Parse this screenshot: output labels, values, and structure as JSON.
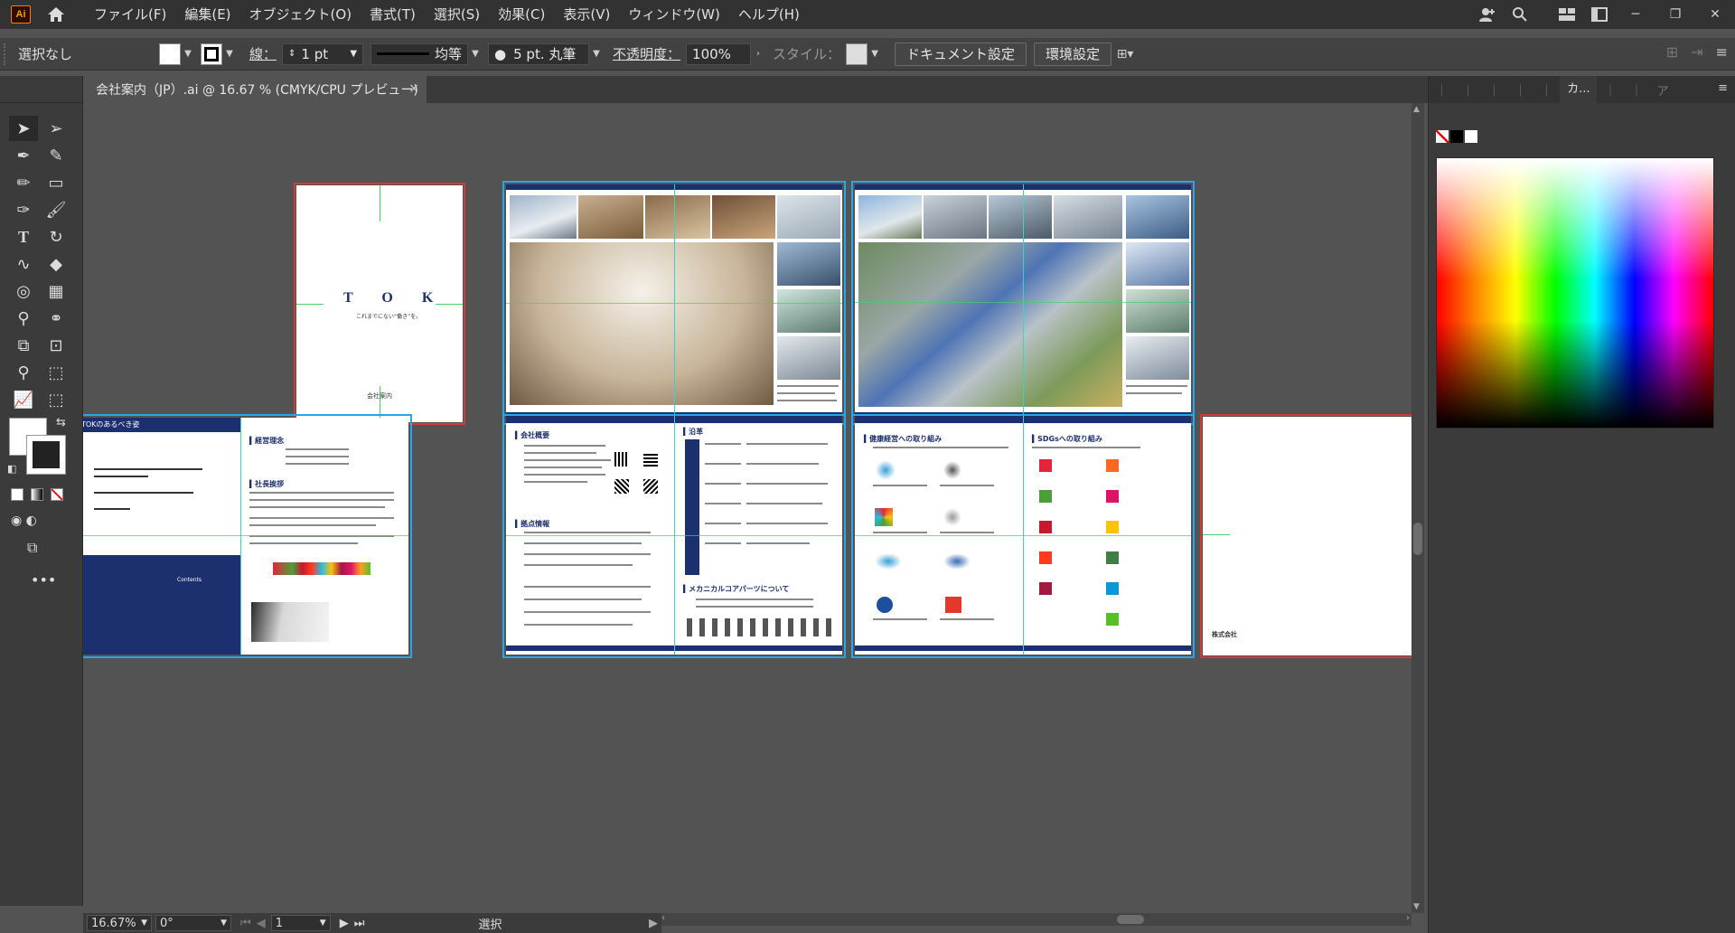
{
  "app": {
    "logo_label": "Ai"
  },
  "menu": [
    "ファイル(F)",
    "編集(E)",
    "オブジェクト(O)",
    "書式(T)",
    "選択(S)",
    "効果(C)",
    "表示(V)",
    "ウィンドウ(W)",
    "ヘルプ(H)"
  ],
  "control": {
    "selection": "選択なし",
    "stroke_label": "線：",
    "stroke_weight": "1 pt",
    "stroke_profile": "均等",
    "brush": "5 pt. 丸筆",
    "opacity_label": "不透明度：",
    "opacity_value": "100%",
    "style_label": "スタイル：",
    "doc_settings": "ドキュメント設定",
    "preferences": "環境設定"
  },
  "tab": {
    "title": "会社案内（JP）.ai @ 16.67 % (CMYK/CPU プレビュー)",
    "close": "×"
  },
  "status": {
    "zoom": "16.67%",
    "rotation": "0°",
    "artboard_num": "1",
    "tool_state": "選択"
  },
  "panel": {
    "tabs": [
      "",
      "",
      "",
      "",
      "",
      "カ...",
      "",
      "",
      "ア"
    ],
    "menu": "≡"
  },
  "artboards": {
    "cover_title": "T O K",
    "cover_sub": "これまでにない“働き”を。",
    "cover_footer": "会社案内",
    "p4_band": "TOKのあるべき姿",
    "p4_h1": "▍経営理念",
    "p4_h2": "▍社長挨拶",
    "p4_contents": "Contents",
    "p5_h1": "▍会社概要",
    "p5_h2": "▍拠点情報",
    "p5_h3": "▍沿革",
    "p5_h4": "▍メカニカルコアパーツについて",
    "p6_h1": "▍健康経営への取り組み",
    "p6_h2": "▍SDGsへの取り組み",
    "p7_company": "株式会社"
  },
  "colors": {
    "accent": "#1c2f6e",
    "artboard_outline": "#2aa6e8",
    "guide": "#41d26a"
  }
}
